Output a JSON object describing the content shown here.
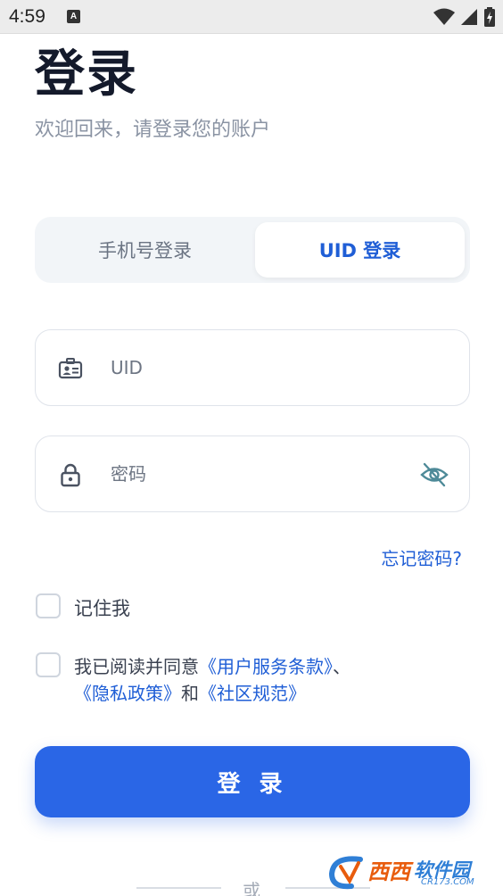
{
  "status_bar": {
    "time": "4:59",
    "notification_badge": "A"
  },
  "header": {
    "title": "登录",
    "subtitle": "欢迎回来，请登录您的账户"
  },
  "tabs": [
    {
      "label": "手机号登录",
      "active": false
    },
    {
      "label": "UID 登录",
      "active": true
    }
  ],
  "form": {
    "uid_placeholder": "UID",
    "password_placeholder": "密码",
    "forgot_password": "忘记密码?",
    "remember_me": "记住我"
  },
  "agreement": {
    "prefix": "我已阅读并同意",
    "terms": "《用户服务条款》",
    "separator": "、",
    "privacy": "《隐私政策》",
    "and": "和",
    "community": "《社区规范》"
  },
  "login_button": "登 录",
  "divider_text": "或",
  "watermark": {
    "brand": "西西",
    "label": "软件园",
    "domain": "CR173.COM"
  },
  "colors": {
    "accent": "#2a66e6",
    "link": "#1f5ed6",
    "title": "#141a2b",
    "muted": "#8a93a3"
  },
  "icons": {
    "uid_field": "id-card-icon",
    "password_field": "lock-icon",
    "toggle_visibility": "eye-off-icon"
  }
}
